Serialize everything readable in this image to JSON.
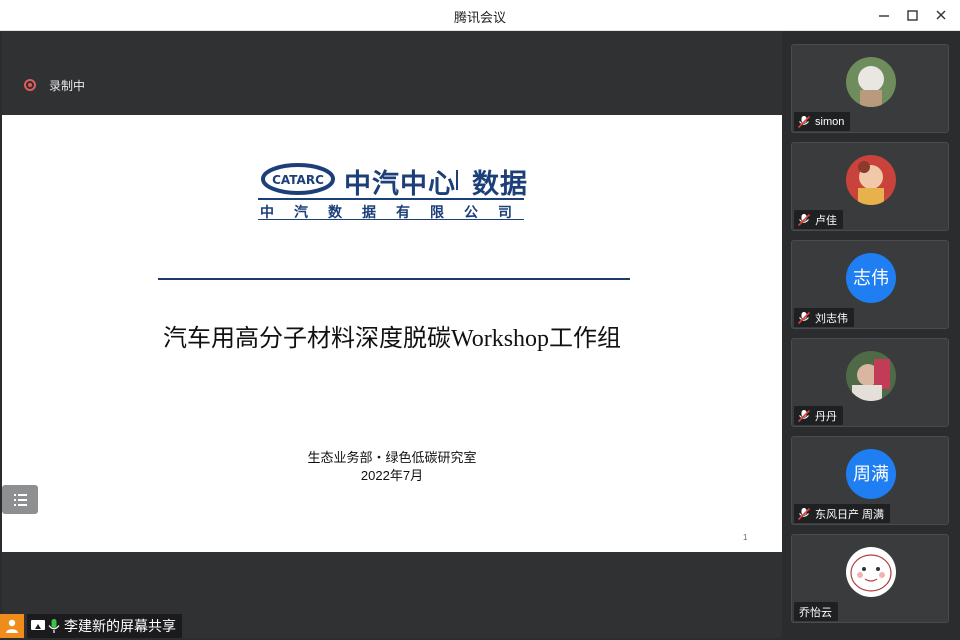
{
  "window": {
    "title": "腾讯会议"
  },
  "recording": {
    "label": "录制中"
  },
  "slide": {
    "logo_cn": "中汽中心",
    "logo_data": "数据",
    "logo_mark": "CATARC",
    "logo_sub": "中汽数据有限公司",
    "title": "汽车用高分子材料深度脱碳Workshop工作组",
    "dept": "生态业务部・绿色低碳研究室",
    "date": "2022年7月",
    "page_number": "1"
  },
  "share_bar": {
    "label": "李建新的屏幕共享"
  },
  "participants": [
    {
      "name": "simon",
      "avatar_type": "photo",
      "mic": "muted"
    },
    {
      "name": "卢佳",
      "avatar_type": "photo",
      "mic": "muted"
    },
    {
      "name": "刘志伟",
      "avatar_type": "text",
      "avatar_text": "志伟",
      "mic": "muted"
    },
    {
      "name": "丹丹",
      "avatar_type": "photo",
      "mic": "muted"
    },
    {
      "name": "东风日产 周满",
      "avatar_type": "text",
      "avatar_text": "周满",
      "mic": "muted"
    },
    {
      "name": "乔怡云",
      "avatar_type": "photo",
      "mic": "none"
    }
  ],
  "colors": {
    "accent": "#1e7ef2",
    "brand_navy": "#1c3f7a",
    "record_red": "#e25b5b",
    "presenter_orange": "#f08c1c",
    "mic_green": "#3ac24a"
  },
  "icons": [
    "minimize-icon",
    "maximize-icon",
    "close-icon",
    "record-icon",
    "list-icon",
    "user-icon",
    "screen-share-icon",
    "mic-icon",
    "mic-muted-icon"
  ]
}
